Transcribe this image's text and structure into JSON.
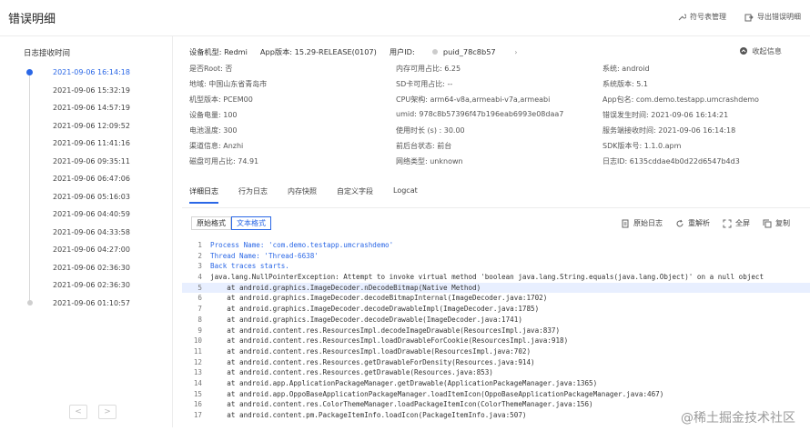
{
  "header": {
    "title": "错误明细",
    "actions": [
      {
        "label": "符号表管理",
        "icon": "wrench-icon"
      },
      {
        "label": "导出错误明细",
        "icon": "export-icon"
      }
    ]
  },
  "sidebar": {
    "title": "日志接收时间",
    "items": [
      "2021-09-06 16:14:18",
      "2021-09-06 15:32:19",
      "2021-09-06 14:57:19",
      "2021-09-06 12:09:52",
      "2021-09-06 11:41:16",
      "2021-09-06 09:35:11",
      "2021-09-06 06:47:06",
      "2021-09-06 05:16:03",
      "2021-09-06 04:40:59",
      "2021-09-06 04:33:58",
      "2021-09-06 04:27:00",
      "2021-09-06 02:36:30",
      "2021-09-06 02:36:30",
      "2021-09-06 01:10:57"
    ],
    "prev": "<",
    "next": ">"
  },
  "info": {
    "device_model": "设备机型: Redmi",
    "app_version": "App版本: 15.29-RELEASE(0107)",
    "user_id": "用户ID:",
    "user_id_value": "puid_78c8b57",
    "user_arrow": "›",
    "collapse": "收起信息",
    "fields": [
      [
        "是否Root: 否",
        "内存可用占比: 6.25",
        "系统: android"
      ],
      [
        "地域: 中国山东省青岛市",
        "SD卡可用占比: --",
        "系统版本: 5.1"
      ],
      [
        "机型版本: PCEM00",
        "CPU架构: arm64-v8a,armeabi-v7a,armeabi",
        "App包名: com.demo.testapp.umcrashdemo"
      ],
      [
        "设备电量: 100",
        "umid: 978c8b57396f47b196eab6993e08daa7",
        "错误发生时间: 2021-09-06 16:14:21"
      ],
      [
        "电池温度: 300",
        "使用时长 (s) : 30.00",
        "服务端接收时间: 2021-09-06 16:14:18"
      ],
      [
        "渠道信息: Anzhi",
        "前后台状态: 前台",
        "SDK版本号: 1.1.0.apm"
      ],
      [
        "磁盘可用占比: 74.91",
        "网络类型: unknown",
        "日志ID: 6135cddae4b0d22d6547b4d3"
      ]
    ]
  },
  "tabs": [
    "详细日志",
    "行为日志",
    "内存快照",
    "自定义字段",
    "Logcat"
  ],
  "format": {
    "raw": "原始格式",
    "text": "文本格式"
  },
  "tools": [
    {
      "label": "原始日志",
      "icon": "document-icon"
    },
    {
      "label": "重解析",
      "icon": "refresh-icon"
    },
    {
      "label": "全屏",
      "icon": "fullscreen-icon"
    },
    {
      "label": "复制",
      "icon": "copy-icon"
    }
  ],
  "code_lines": [
    {
      "n": "1",
      "t": "Process Name: 'com.demo.testapp.umcrashdemo'"
    },
    {
      "n": "2",
      "t": "Thread Name: 'Thread-6638'"
    },
    {
      "n": "3",
      "t": "Back traces starts."
    },
    {
      "n": "4",
      "t": "java.lang.NullPointerException: Attempt to invoke virtual method 'boolean java.lang.String.equals(java.lang.Object)' on a null object"
    },
    {
      "n": "5",
      "t": "    at android.graphics.ImageDecoder.nDecodeBitmap(Native Method)"
    },
    {
      "n": "6",
      "t": "    at android.graphics.ImageDecoder.decodeBitmapInternal(ImageDecoder.java:1702)"
    },
    {
      "n": "7",
      "t": "    at android.graphics.ImageDecoder.decodeDrawableImpl(ImageDecoder.java:1785)"
    },
    {
      "n": "8",
      "t": "    at android.graphics.ImageDecoder.decodeDrawable(ImageDecoder.java:1741)"
    },
    {
      "n": "9",
      "t": "    at android.content.res.ResourcesImpl.decodeImageDrawable(ResourcesImpl.java:837)"
    },
    {
      "n": "10",
      "t": "    at android.content.res.ResourcesImpl.loadDrawableForCookie(ResourcesImpl.java:918)"
    },
    {
      "n": "11",
      "t": "    at android.content.res.ResourcesImpl.loadDrawable(ResourcesImpl.java:702)"
    },
    {
      "n": "12",
      "t": "    at android.content.res.Resources.getDrawableForDensity(Resources.java:914)"
    },
    {
      "n": "13",
      "t": "    at android.content.res.Resources.getDrawable(Resources.java:853)"
    },
    {
      "n": "14",
      "t": "    at android.app.ApplicationPackageManager.getDrawable(ApplicationPackageManager.java:1365)"
    },
    {
      "n": "15",
      "t": "    at android.app.OppoBaseApplicationPackageManager.loadItemIcon(OppoBaseApplicationPackageManager.java:467)"
    },
    {
      "n": "16",
      "t": "    at android.content.res.ColorThemeManager.loadPackageItemIcon(ColorThemeManager.java:156)"
    },
    {
      "n": "17",
      "t": "    at android.content.pm.PackageItemInfo.loadIcon(PackageItemInfo.java:507)"
    }
  ],
  "watermark": "@稀土掘金技术社区",
  "colors": {
    "accent": "#2a67e6",
    "highlight": "#e8efff"
  }
}
